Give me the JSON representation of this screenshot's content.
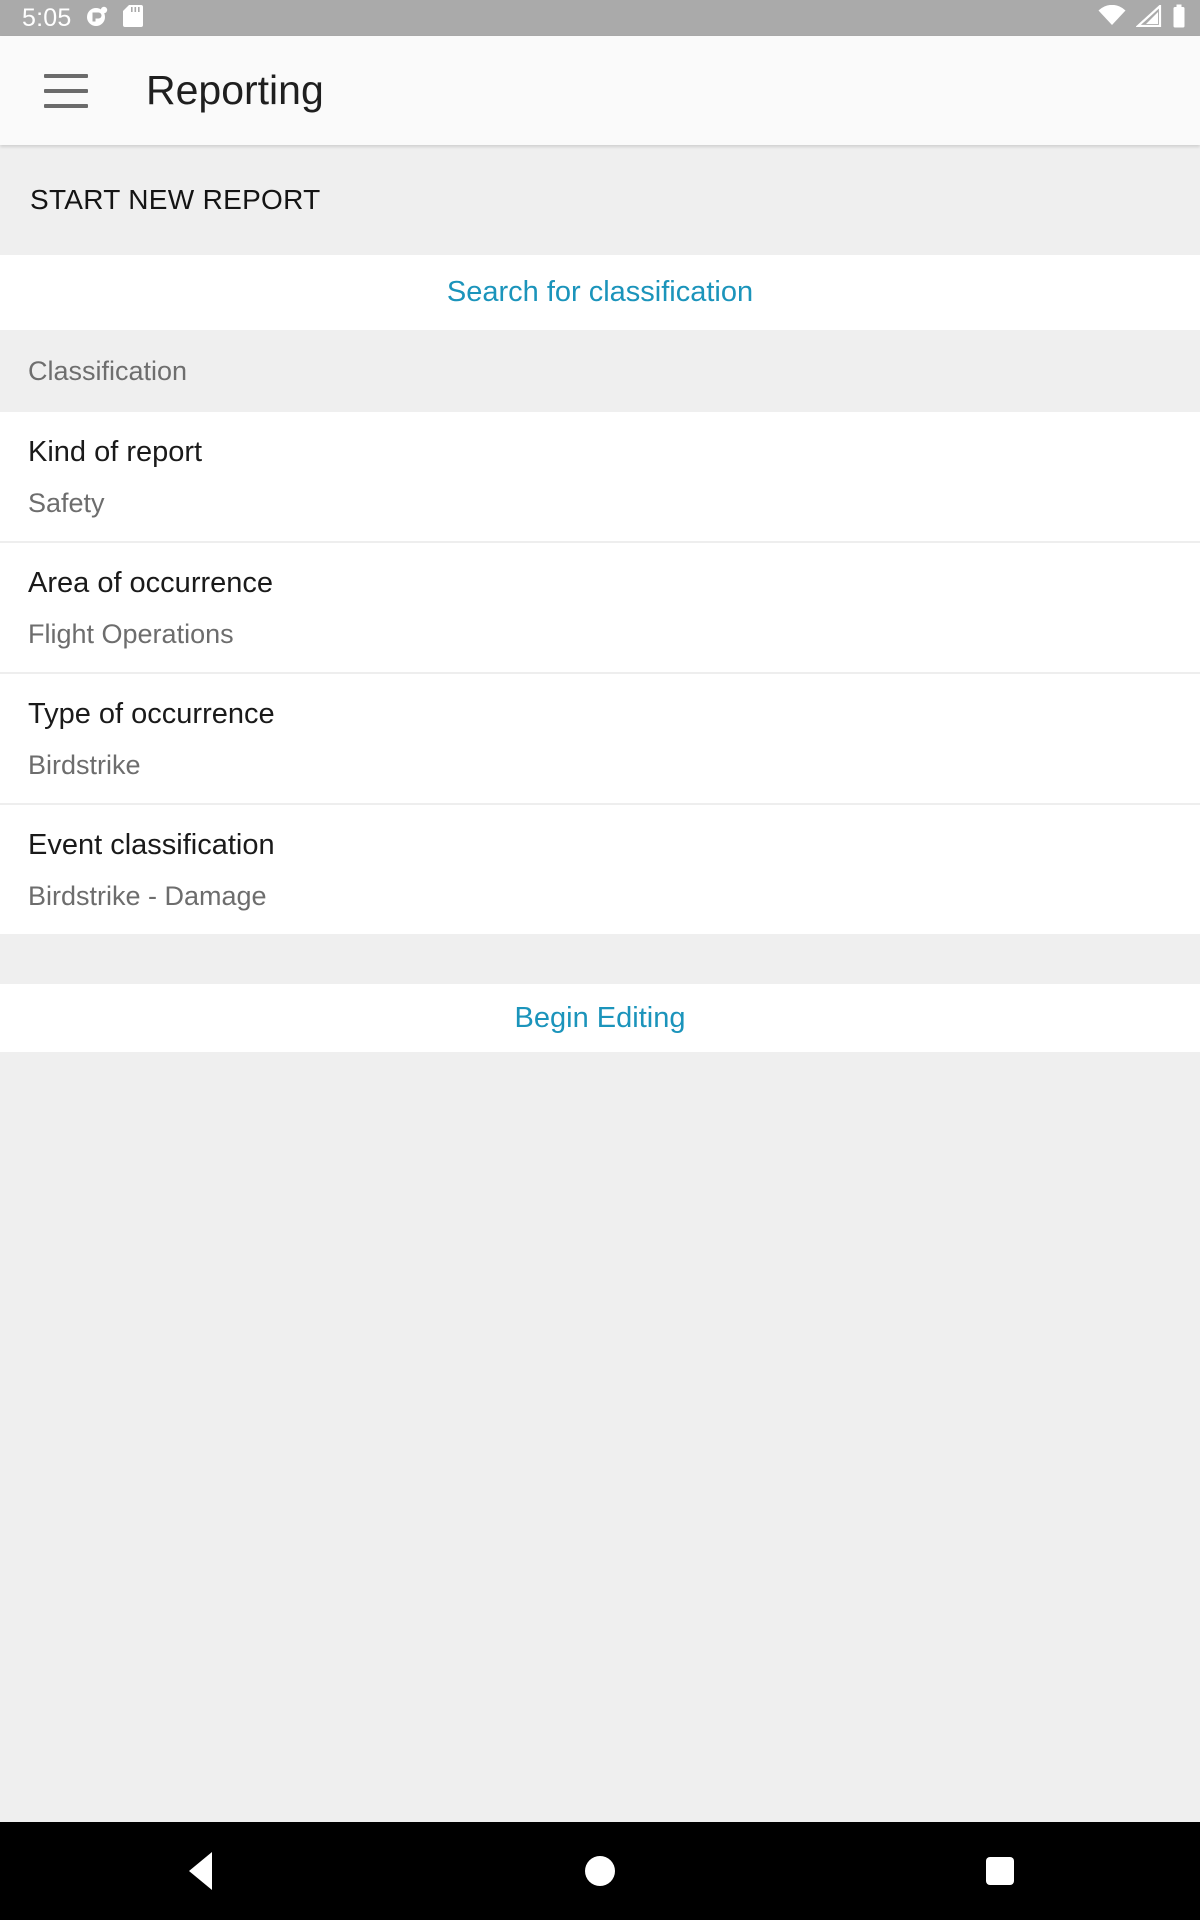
{
  "status_bar": {
    "clock": "5:05",
    "left_icons": [
      "app-badge-icon",
      "sd-card-icon"
    ],
    "right_icons": [
      "wifi-icon",
      "cell-signal-icon",
      "battery-icon"
    ],
    "background": "#aaaaaa"
  },
  "app_bar": {
    "menu_icon": "hamburger-menu-icon",
    "title": "Reporting",
    "background": "#fafafa"
  },
  "sections": {
    "start_new_report_label": "START NEW REPORT",
    "classification_label": "Classification"
  },
  "actions": {
    "search_label": "Search for classification",
    "begin_editing_label": "Begin Editing",
    "accent_color": "#1b94bb"
  },
  "classification_items": [
    {
      "label": "Kind of report",
      "value": "Safety"
    },
    {
      "label": "Area of occurrence",
      "value": "Flight Operations"
    },
    {
      "label": "Type of occurrence",
      "value": "Birdstrike"
    },
    {
      "label": "Event classification",
      "value": "Birdstrike - Damage"
    }
  ],
  "nav_bar": {
    "back_icon": "back-triangle-icon",
    "home_icon": "home-circle-icon",
    "recents_icon": "recents-square-icon",
    "background": "#000000"
  }
}
